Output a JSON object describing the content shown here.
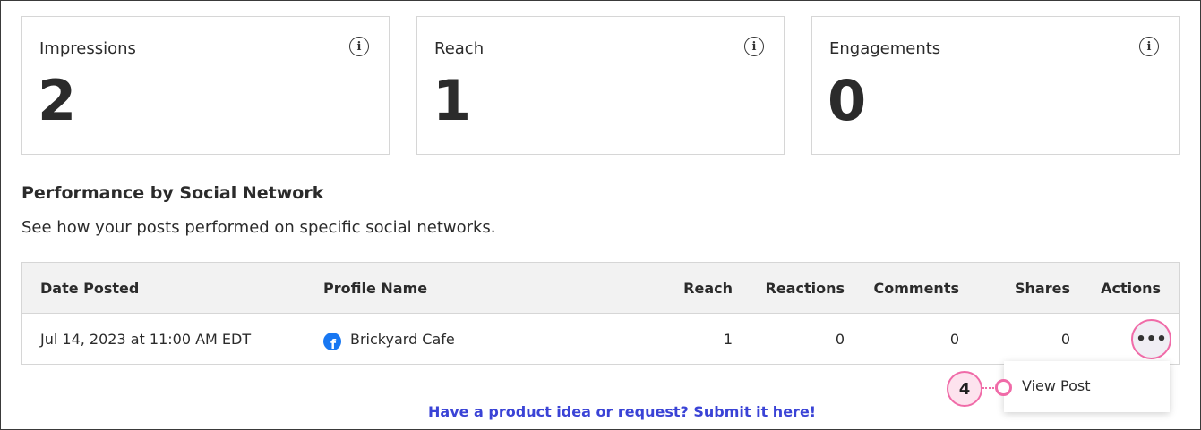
{
  "stats": [
    {
      "label": "Impressions",
      "value": "2"
    },
    {
      "label": "Reach",
      "value": "1"
    },
    {
      "label": "Engagements",
      "value": "0"
    }
  ],
  "section": {
    "title": "Performance by Social Network",
    "subtitle": "See how your posts performed on specific social networks."
  },
  "table": {
    "headers": [
      "Date Posted",
      "Profile Name",
      "Reach",
      "Reactions",
      "Comments",
      "Shares",
      "Actions"
    ],
    "rows": [
      {
        "date": "Jul 14, 2023 at 11:00 AM EDT",
        "network_icon": "facebook-icon",
        "profile": "Brickyard Cafe",
        "reach": "1",
        "reactions": "0",
        "comments": "0",
        "shares": "0",
        "actions_label": "•••"
      }
    ]
  },
  "menu": {
    "items": [
      "View Post"
    ]
  },
  "callout": {
    "number": "4"
  },
  "footer": {
    "link": "Have a product idea or request? Submit it here!"
  },
  "colors": {
    "accent_pink": "#f06ba8",
    "link_blue": "#3a43d6",
    "facebook_blue": "#1877f2"
  }
}
